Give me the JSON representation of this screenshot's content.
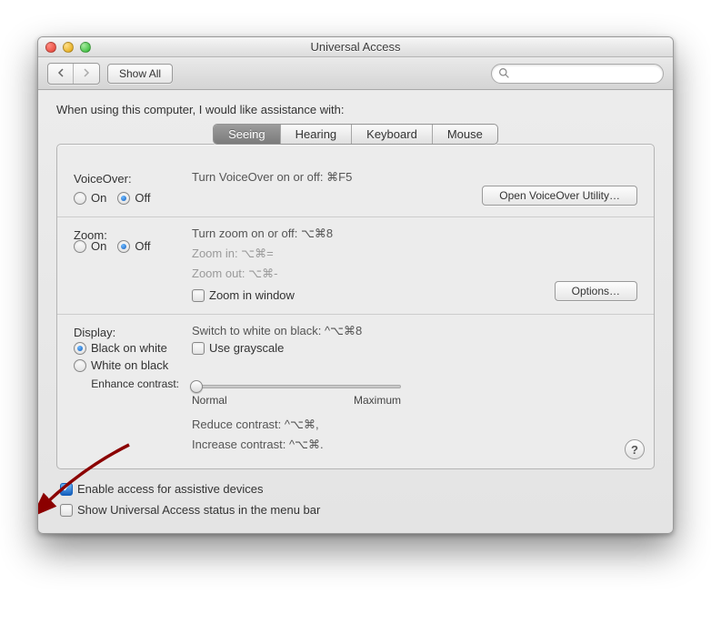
{
  "window": {
    "title": "Universal Access"
  },
  "toolbar": {
    "show_all": "Show All",
    "search_placeholder": ""
  },
  "intro": "When using this computer, I would like assistance with:",
  "tabs": [
    "Seeing",
    "Hearing",
    "Keyboard",
    "Mouse"
  ],
  "active_tab": 0,
  "voiceover": {
    "label": "VoiceOver:",
    "hint": "Turn VoiceOver on or off: ⌘F5",
    "on": "On",
    "off": "Off",
    "selected": "off",
    "open_util": "Open VoiceOver Utility…"
  },
  "zoom": {
    "label": "Zoom:",
    "hint": "Turn zoom on or off: ⌥⌘8",
    "zoom_in": "Zoom in: ⌥⌘=",
    "zoom_out": "Zoom out: ⌥⌘-",
    "on": "On",
    "off": "Off",
    "selected": "off",
    "zoom_in_window": "Zoom in window",
    "zoom_in_window_checked": false,
    "options": "Options…"
  },
  "display": {
    "label": "Display:",
    "hint": "Switch to white on black: ^⌥⌘8",
    "black_on_white": "Black on white",
    "white_on_black": "White on black",
    "selected": "black_on_white",
    "use_grayscale": "Use grayscale",
    "use_grayscale_checked": false
  },
  "contrast": {
    "label": "Enhance contrast:",
    "min": "Normal",
    "max": "Maximum",
    "reduce": "Reduce contrast: ^⌥⌘,",
    "increase": "Increase contrast: ^⌥⌘."
  },
  "footer": {
    "enable_assistive": "Enable access for assistive devices",
    "enable_assistive_checked": true,
    "show_status": "Show Universal Access status in the menu bar",
    "show_status_checked": false
  }
}
